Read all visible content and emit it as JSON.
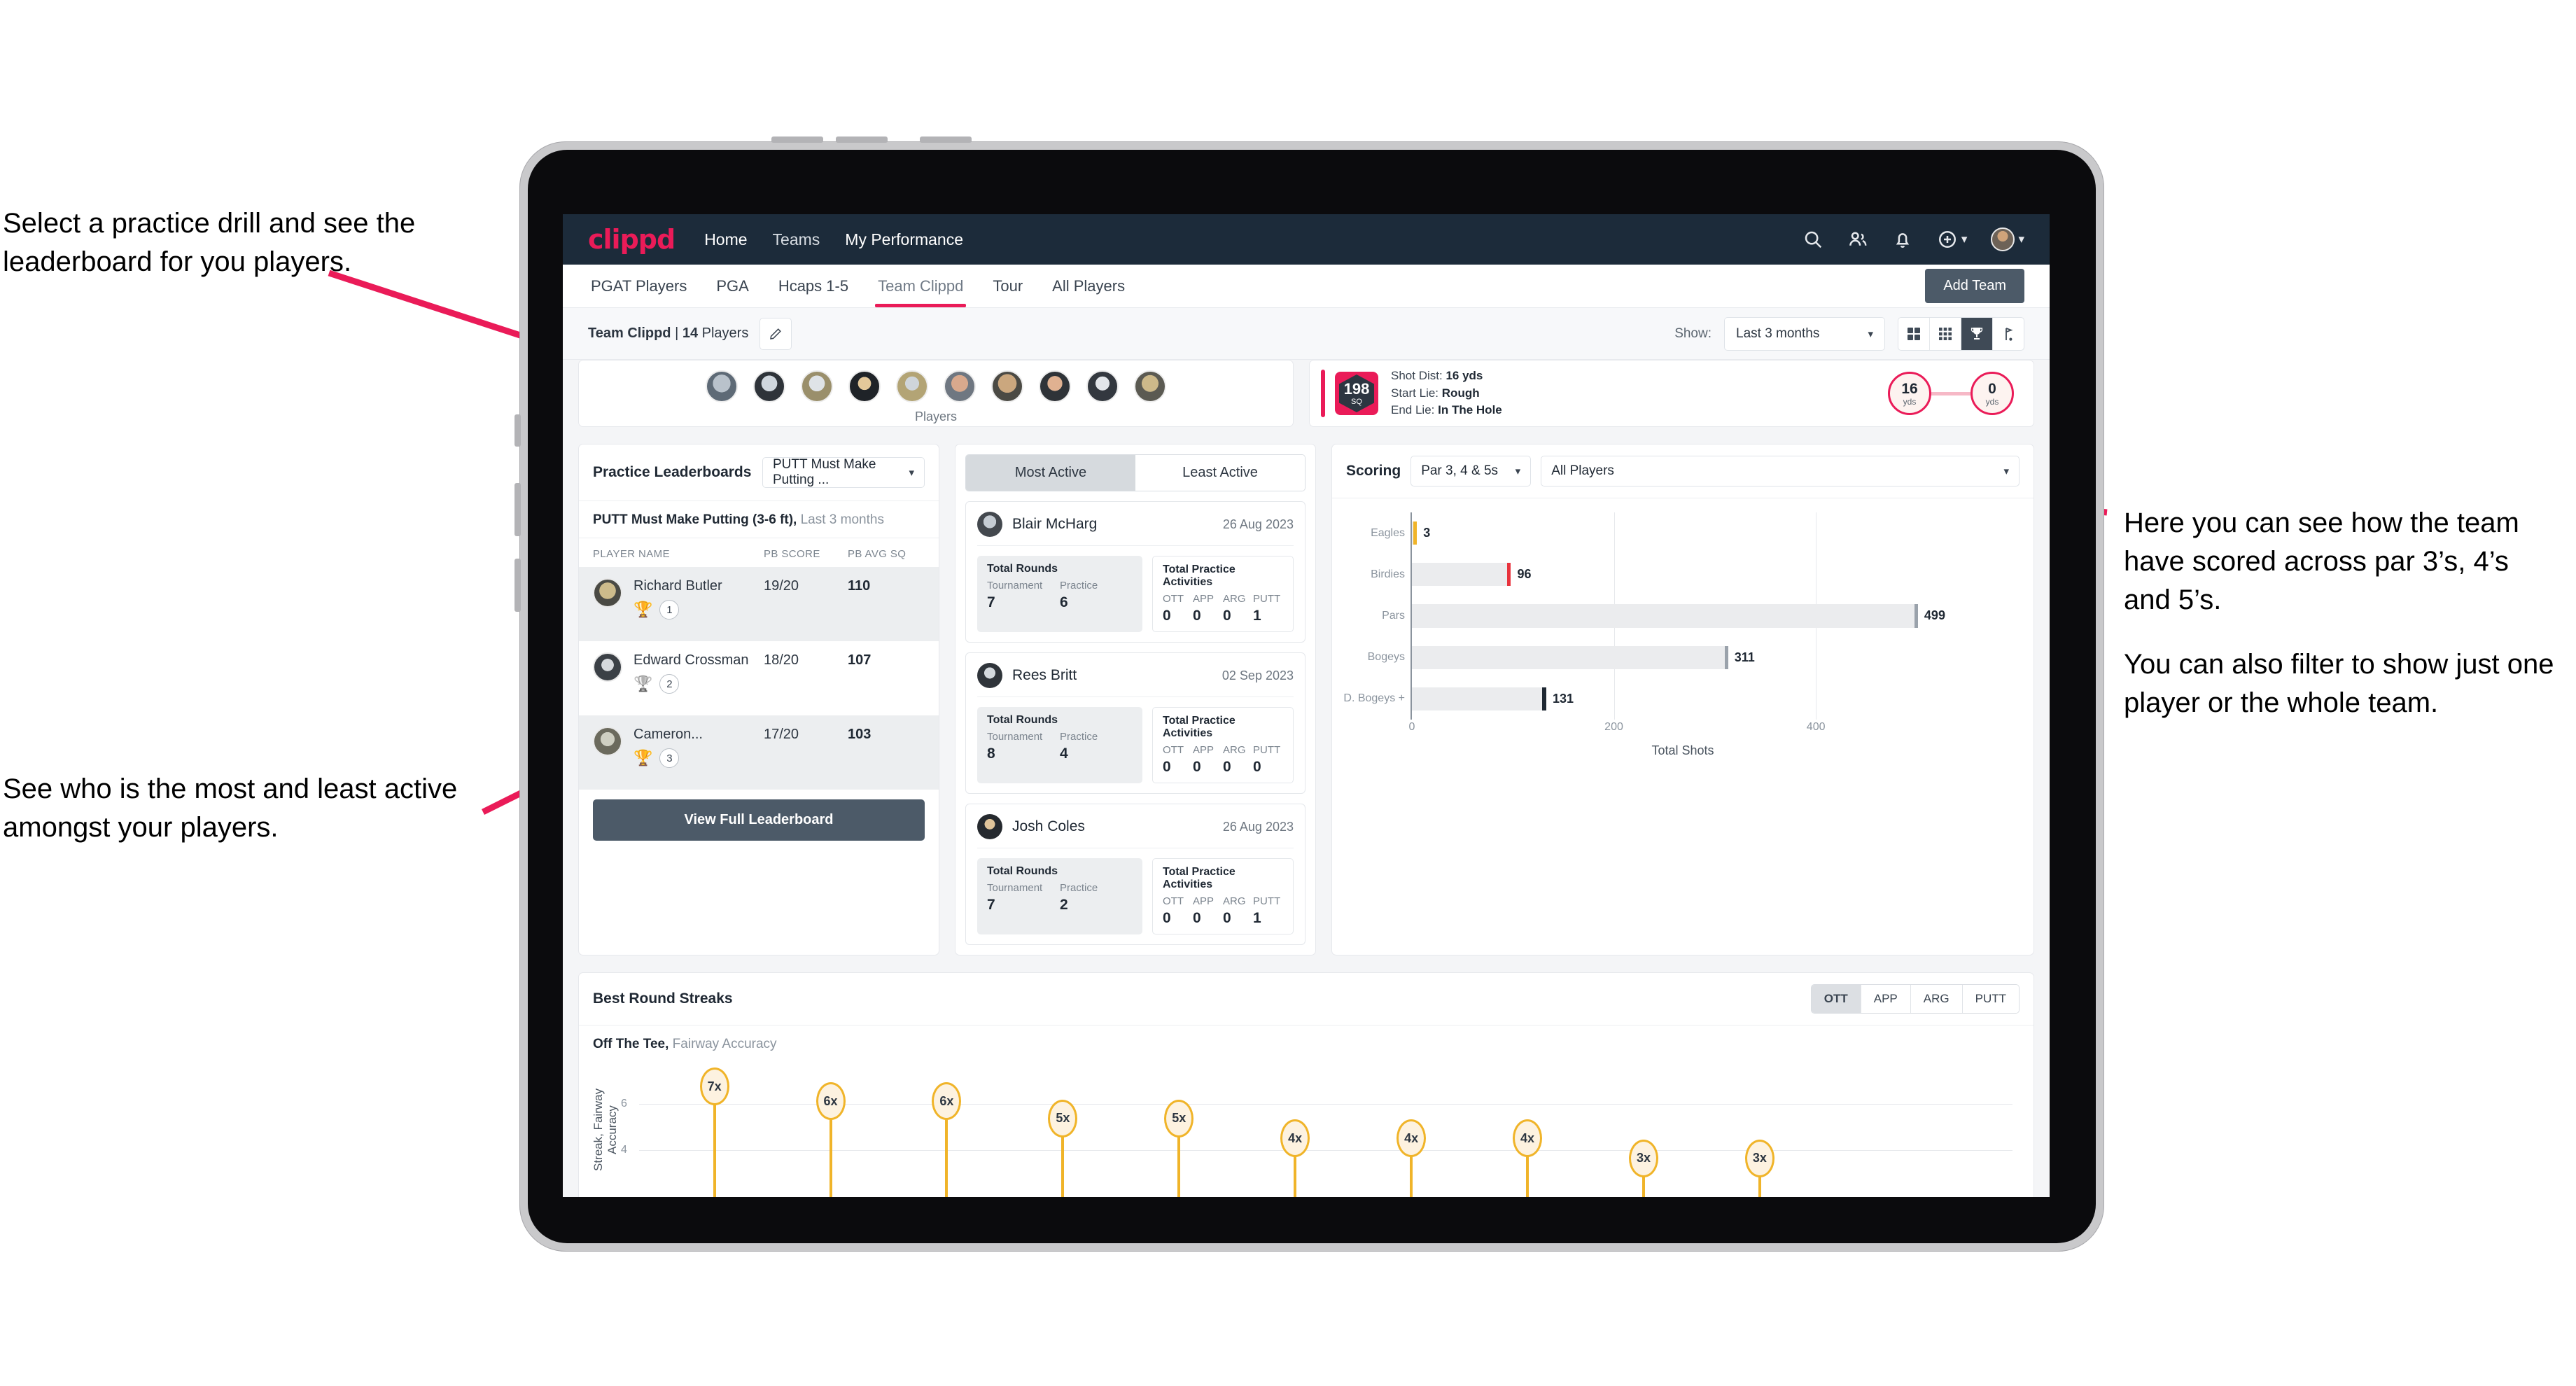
{
  "annotations": {
    "top_left": "Select a practice drill and see the leaderboard for you players.",
    "bottom_left": "See who is the most and least active amongst your players.",
    "right_p1": "Here you can see how the team have scored across par 3’s, 4’s and 5’s.",
    "right_p2": "You can also filter to show just one player or the whole team."
  },
  "colors": {
    "brand_pink": "#ea1b58",
    "navy": "#1c2b3a",
    "slate": "#4c5a68",
    "amber": "#f0b429"
  },
  "appbar": {
    "logo": "clippd",
    "nav": [
      {
        "label": "Home",
        "active": true
      },
      {
        "label": "Teams",
        "active": false
      },
      {
        "label": "My Performance",
        "active": true
      }
    ],
    "icons": [
      "search-icon",
      "people-icon",
      "bell-icon",
      "plus-circle-icon",
      "avatar"
    ]
  },
  "tabs": {
    "items": [
      {
        "label": "PGAT Players",
        "active": false
      },
      {
        "label": "PGA",
        "active": false
      },
      {
        "label": "Hcaps 1-5",
        "active": false
      },
      {
        "label": "Team Clippd",
        "active": true
      },
      {
        "label": "Tour",
        "active": false
      },
      {
        "label": "All Players",
        "active": false
      }
    ],
    "add_team_button": "Add Team"
  },
  "filterbar": {
    "team_name": "Team Clippd",
    "separator": " | ",
    "player_count": "14",
    "players_word": " Players",
    "show_label": "Show:",
    "period_value": "Last 3 months",
    "view_modes": [
      "grid-large-icon",
      "grid-small-icon",
      "trophy-icon",
      "flag-icon"
    ],
    "selected_view": "trophy-icon"
  },
  "top_panel": {
    "players_caption": "Players",
    "avatar_count": 10
  },
  "shot_card": {
    "sq_value": "198",
    "sq_unit": "SQ",
    "lines": [
      {
        "label": "Shot Dist:",
        "value": "16 yds"
      },
      {
        "label": "Start Lie:",
        "value": "Rough"
      },
      {
        "label": "End Lie:",
        "value": "In The Hole"
      }
    ],
    "start_dist": "16",
    "start_unit": "yds",
    "end_dist": "0",
    "end_unit": "yds"
  },
  "practice_leaderboards": {
    "title": "Practice Leaderboards",
    "drill_select": "PUTT Must Make Putting ...",
    "subtitle_bold": "PUTT Must Make Putting (3-6 ft),",
    "subtitle_rest": " Last 3 months",
    "columns": [
      "PLAYER NAME",
      "PB SCORE",
      "PB AVG SQ"
    ],
    "rows": [
      {
        "name": "Richard Butler",
        "rank": "1",
        "medal": "gold",
        "pb_score": "19/20",
        "pb_avg_sq": "110"
      },
      {
        "name": "Edward Crossman",
        "rank": "2",
        "medal": "silver",
        "pb_score": "18/20",
        "pb_avg_sq": "107"
      },
      {
        "name": "Cameron...",
        "rank": "3",
        "medal": "bronze",
        "pb_score": "17/20",
        "pb_avg_sq": "103"
      }
    ],
    "view_button": "View Full Leaderboard"
  },
  "activity": {
    "tabs": [
      {
        "label": "Most Active",
        "active": true
      },
      {
        "label": "Least Active",
        "active": false
      }
    ],
    "rounds_title": "Total Rounds",
    "activities_title": "Total Practice Activities",
    "rounds_keys": [
      "Tournament",
      "Practice"
    ],
    "activity_keys": [
      "OTT",
      "APP",
      "ARG",
      "PUTT"
    ],
    "cards": [
      {
        "name": "Blair McHarg",
        "date": "26 Aug 2023",
        "tournament": "7",
        "practice": "6",
        "ott": "0",
        "app": "0",
        "arg": "0",
        "putt": "1"
      },
      {
        "name": "Rees Britt",
        "date": "02 Sep 2023",
        "tournament": "8",
        "practice": "4",
        "ott": "0",
        "app": "0",
        "arg": "0",
        "putt": "0"
      },
      {
        "name": "Josh Coles",
        "date": "26 Aug 2023",
        "tournament": "7",
        "practice": "2",
        "ott": "0",
        "app": "0",
        "arg": "0",
        "putt": "1"
      }
    ]
  },
  "scoring": {
    "title": "Scoring",
    "par_select": "Par 3, 4 & 5s",
    "player_select": "All Players",
    "chart_data": {
      "type": "bar",
      "orientation": "horizontal",
      "title": "Scoring",
      "categories": [
        "Eagles",
        "Birdies",
        "Pars",
        "Bogeys",
        "D. Bogeys +"
      ],
      "values": [
        3,
        96,
        499,
        311,
        131
      ],
      "cap_colors": [
        "#f0b429",
        "#e8323c",
        "#9aa2ab",
        "#9aa2ab",
        "#1f2833"
      ],
      "xlabel": "Total Shots",
      "ylabel": "",
      "xlim": [
        0,
        560
      ],
      "xticks": [
        0,
        200,
        400
      ],
      "grid": true,
      "legend": "none"
    }
  },
  "streaks": {
    "title": "Best Round Streaks",
    "toggle": [
      {
        "label": "OTT",
        "active": true
      },
      {
        "label": "APP",
        "active": false
      },
      {
        "label": "ARG",
        "active": false
      },
      {
        "label": "PUTT",
        "active": false
      }
    ],
    "subtitle_bold": "Off The Tee,",
    "subtitle_rest": " Fairway Accuracy",
    "chart_data": {
      "type": "bar",
      "subtype": "lollipop",
      "title": "Best Round Streaks",
      "ylabel": "Streak, Fairway Accuracy",
      "yticks": [
        4,
        6
      ],
      "ylim": [
        0,
        8
      ],
      "labels": [
        "7x",
        "6x",
        "6x",
        "5x",
        "5x",
        "4x",
        "4x",
        "4x",
        "3x",
        "3x"
      ],
      "values": [
        7,
        6,
        6,
        5,
        5,
        4,
        4,
        4,
        3,
        3
      ],
      "grid": true
    }
  }
}
